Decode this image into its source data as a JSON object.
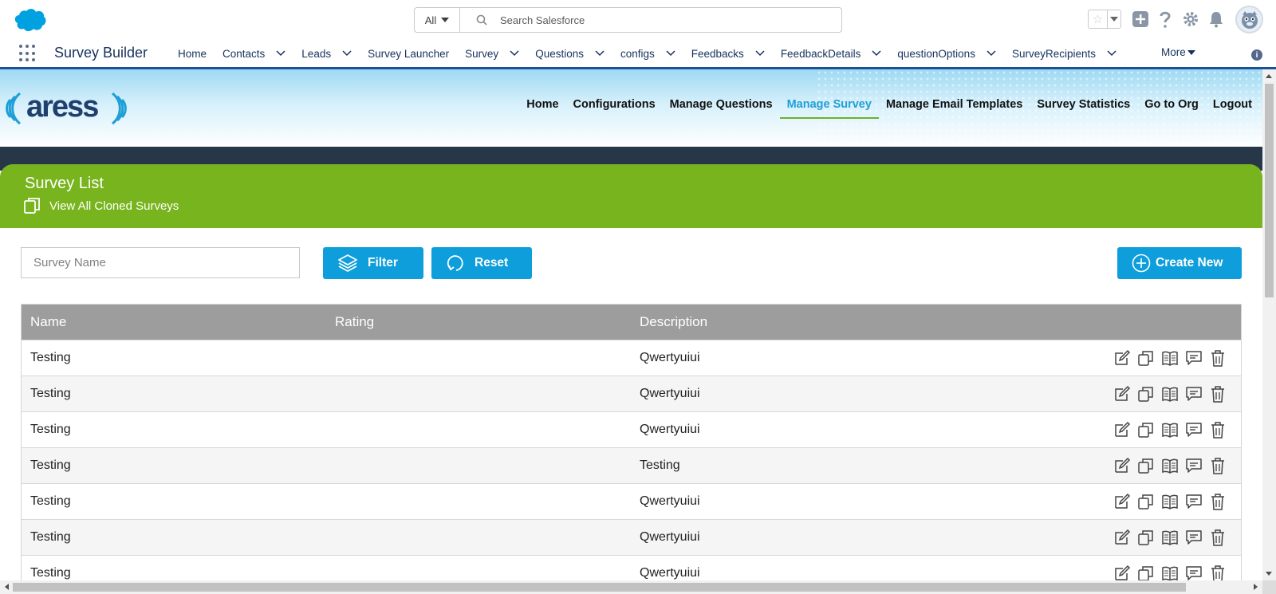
{
  "global_header": {
    "search_scope": "All",
    "search_placeholder": "Search Salesforce"
  },
  "app_nav": {
    "app_name": "Survey Builder",
    "items": [
      {
        "label": "Home",
        "has_menu": false
      },
      {
        "label": "Contacts",
        "has_menu": true
      },
      {
        "label": "Leads",
        "has_menu": true
      },
      {
        "label": "Survey Launcher",
        "has_menu": false
      },
      {
        "label": "Survey",
        "has_menu": true
      },
      {
        "label": "Questions",
        "has_menu": true
      },
      {
        "label": "configs",
        "has_menu": true
      },
      {
        "label": "Feedbacks",
        "has_menu": true
      },
      {
        "label": "FeedbackDetails",
        "has_menu": true
      },
      {
        "label": "questionOptions",
        "has_menu": true
      },
      {
        "label": "SurveyRecipients",
        "has_menu": true
      }
    ],
    "more_label": "More"
  },
  "banner": {
    "brand": "aress",
    "menu": [
      {
        "label": "Home",
        "active": false
      },
      {
        "label": "Configurations",
        "active": false
      },
      {
        "label": "Manage Questions",
        "active": false
      },
      {
        "label": "Manage Survey",
        "active": true
      },
      {
        "label": "Manage Email Templates",
        "active": false
      },
      {
        "label": "Survey Statistics",
        "active": false
      },
      {
        "label": "Go to Org",
        "active": false
      },
      {
        "label": "Logout",
        "active": false
      }
    ]
  },
  "panel": {
    "title": "Survey List",
    "cloned_link": "View All Cloned Surveys"
  },
  "toolbar": {
    "survey_name_placeholder": "Survey Name",
    "filter_label": "Filter",
    "reset_label": "Reset",
    "create_label": "Create New"
  },
  "table": {
    "columns": [
      "Name",
      "Rating",
      "Description"
    ],
    "rows": [
      {
        "name": "Testing",
        "rating": "",
        "description": "Qwertyuiui"
      },
      {
        "name": "Testing",
        "rating": "",
        "description": "Qwertyuiui"
      },
      {
        "name": "Testing",
        "rating": "",
        "description": "Qwertyuiui"
      },
      {
        "name": "Testing",
        "rating": "",
        "description": "Testing"
      },
      {
        "name": "Testing",
        "rating": "",
        "description": "Qwertyuiui"
      },
      {
        "name": "Testing",
        "rating": "",
        "description": "Qwertyuiui"
      },
      {
        "name": "Testing",
        "rating": "",
        "description": "Qwertyuiui"
      }
    ],
    "row_actions": [
      "edit-icon",
      "clone-icon",
      "book-icon",
      "comment-icon",
      "trash-icon"
    ]
  },
  "colors": {
    "salesforce_blue": "#00a1e0",
    "header_green": "#78b41e",
    "button_blue": "#0e9edb",
    "active_menu": "#1e9fd6",
    "table_header": "#9d9d9d"
  }
}
